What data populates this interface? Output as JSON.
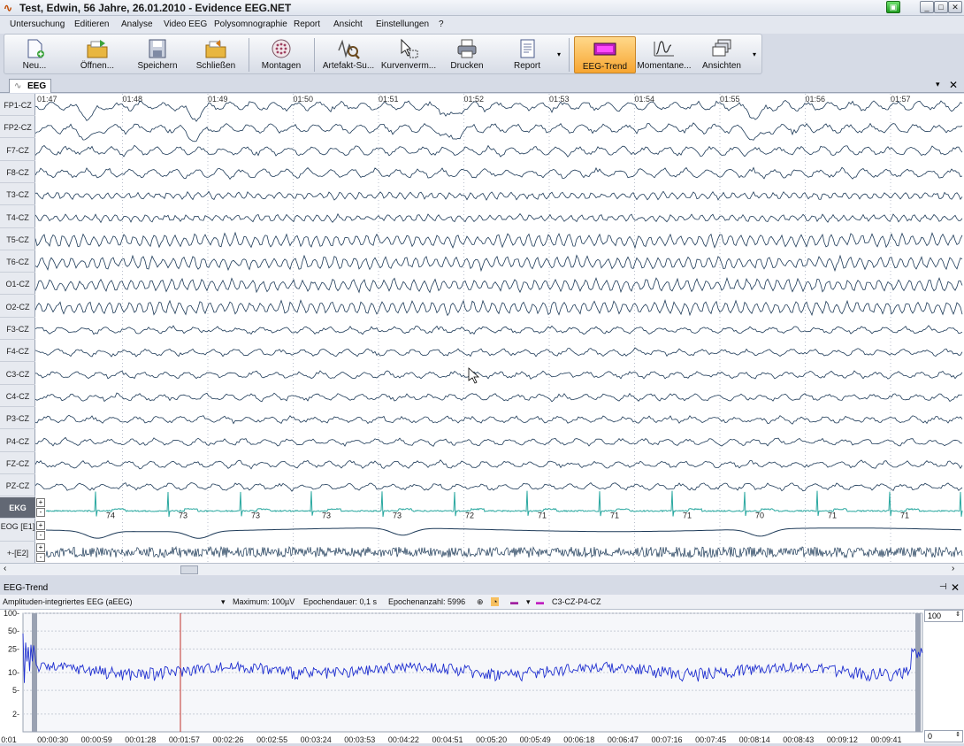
{
  "window": {
    "title": "Test, Edwin, 56 Jahre, 26.01.2010 - Evidence EEG.NET",
    "min": "_",
    "max": "□",
    "close": "✕"
  },
  "menu": [
    "Untersuchung",
    "Editieren",
    "Analyse",
    "Video EEG",
    "Polysomnographie",
    "Report",
    "Ansicht",
    "Einstellungen",
    "?"
  ],
  "toolbar": [
    {
      "label": "Neu...",
      "icon": "new-document-icon"
    },
    {
      "label": "Öffnen...",
      "icon": "open-folder-icon"
    },
    {
      "label": "Speichern",
      "icon": "save-disk-icon"
    },
    {
      "label": "Schließen",
      "icon": "close-folder-icon"
    },
    {
      "label": "Montagen",
      "icon": "montage-head-icon"
    },
    {
      "label": "Artefakt-Su...",
      "icon": "artifact-search-icon"
    },
    {
      "label": "Kurvenverm...",
      "icon": "curve-measure-icon"
    },
    {
      "label": "Drucken",
      "icon": "printer-icon"
    },
    {
      "label": "Report",
      "icon": "report-icon"
    },
    {
      "label": "EEG-Trend",
      "icon": "eeg-trend-icon"
    },
    {
      "label": "Momentane...",
      "icon": "momentary-icon"
    },
    {
      "label": "Ansichten",
      "icon": "views-icon"
    }
  ],
  "tab": {
    "label": "EEG"
  },
  "time_ticks": [
    "01:47",
    "01:48",
    "01:49",
    "01:50",
    "01:51",
    "01:52",
    "01:53",
    "01:54",
    "01:55",
    "01:56",
    "01:57"
  ],
  "channels": [
    "FP1-CZ",
    "FP2-CZ",
    "F7-CZ",
    "F8-CZ",
    "T3-CZ",
    "T4-CZ",
    "T5-CZ",
    "T6-CZ",
    "O1-CZ",
    "O2-CZ",
    "F3-CZ",
    "F4-CZ",
    "C3-CZ",
    "C4-CZ",
    "P3-CZ",
    "P4-CZ",
    "FZ-CZ",
    "PZ-CZ"
  ],
  "aux_channels": [
    "EKG",
    "EOG [E1]",
    "+-[E2]"
  ],
  "heart_rates": [
    "74",
    "73",
    "73",
    "73",
    "73",
    "72",
    "71",
    "71",
    "71",
    "70",
    "71",
    "71"
  ],
  "trend": {
    "panel_title": "EEG-Trend",
    "mode": "Amplituden-integriertes EEG (aEEG)",
    "maximum": "Maximum: 100µV",
    "epoch_duration": "Epochendauer: 0,1 s",
    "epoch_count": "Epochenanzahl: 5996",
    "channel": "C3-CZ-P4-CZ",
    "max_input": "100",
    "min_input": "0",
    "y_ticks": [
      "100",
      "50",
      "25",
      "10",
      "5",
      "2"
    ],
    "x_ticks": [
      "0:01",
      "00:00:30",
      "00:00:59",
      "00:01:28",
      "00:01:57",
      "00:02:26",
      "00:02:55",
      "00:03:24",
      "00:03:53",
      "00:04:22",
      "00:04:51",
      "00:05:20",
      "00:05:49",
      "00:06:18",
      "00:06:47",
      "00:07:16",
      "00:07:45",
      "00:08:14",
      "00:08:43",
      "00:09:12",
      "00:09:41"
    ],
    "colors": {
      "trace": "#1f2fd0",
      "cursor": "#c0302a"
    }
  },
  "colors": {
    "eeg": "#1d3a58",
    "ekg": "#2aa8a0",
    "active_tool": "#f7b548"
  }
}
